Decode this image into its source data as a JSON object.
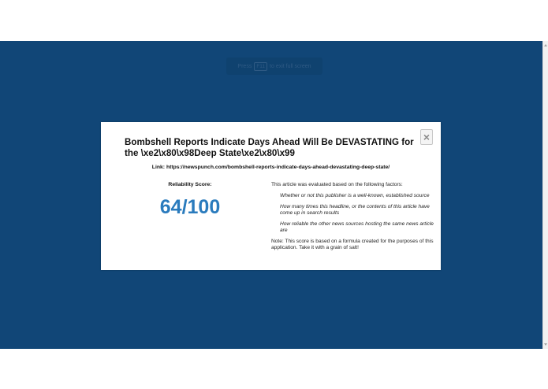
{
  "fullscreen_hint": {
    "prefix": "Press",
    "key": "F11",
    "suffix": "to exit full screen"
  },
  "modal": {
    "close_label": "×",
    "title": "Bombshell Reports Indicate Days Ahead Will Be DEVASTATING for the \\xe2\\x80\\x98Deep State\\xe2\\x80\\x99",
    "link_label": "Link:",
    "link_url": "https://newspunch.com/bombshell-reports-indicate-days-ahead-devastating-deep-state/",
    "score_label": "Reliability Score:",
    "score_value": "64/100",
    "factors_intro": "This article was evaluated based on the following factors:",
    "factors": [
      "Whether or not this publisher is a well-known, established source",
      "How many times this headline, or the contents of this article have come up in search results",
      "How reliable the other news sources hosting the same news article are"
    ],
    "note": "Note: This score is based on a formula created for the purposes of this application. Take it with a grain of salt!"
  },
  "colors": {
    "background": "#114677",
    "score": "#2a7bbd"
  }
}
